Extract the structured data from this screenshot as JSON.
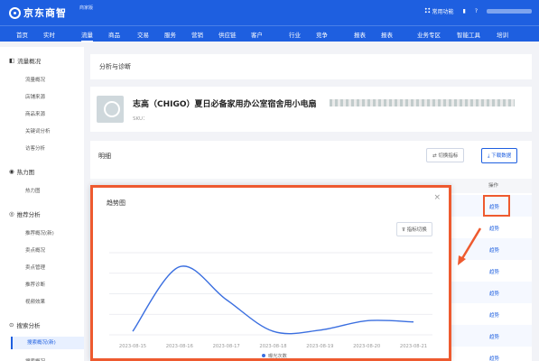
{
  "header": {
    "logo_text": "京东商智",
    "logo_badge": "商家版",
    "common_functions": "常用功能",
    "user_name_hidden": ""
  },
  "nav": {
    "items": [
      "首页",
      "实时",
      "流量",
      "商品",
      "交易",
      "服务",
      "营销",
      "供应链",
      "客户",
      "行业",
      "竞争",
      "报表",
      "报表",
      "业务专区",
      "智能工具",
      "培训"
    ],
    "active_index": 2
  },
  "sidebar": {
    "groups": [
      {
        "label": "流量概况",
        "items": [
          "流量概况",
          "店铺来源",
          "商品来源",
          "关键词分析",
          "访客分析"
        ]
      },
      {
        "label": "热力图",
        "items": [
          "热力图"
        ]
      },
      {
        "label": "推荐分析",
        "items": [
          "推荐概况(新)",
          "卖点概况",
          "卖点管理",
          "推荐诊断",
          "视频效果"
        ]
      },
      {
        "label": "搜索分析",
        "items": [
          "搜索概况(新)",
          "搜索概况"
        ]
      }
    ],
    "active_item": "搜索概况(新)"
  },
  "main": {
    "breadcrumb": "分析与诊断",
    "product_title": "志高（CHIGO）夏日必备家用办公室宿舍用小电扇",
    "product_sku_label": "SKU：",
    "detail_title": "明细",
    "switch_metric_btn": "切换指标",
    "download_btn": "下载数据",
    "op_header": "操作",
    "row_action": "趋势"
  },
  "modal": {
    "title": "趋势图",
    "metric_switch": "指标切换",
    "close": "×"
  },
  "chart_data": {
    "type": "line",
    "x": [
      "2023-08-15",
      "2023-08-16",
      "2023-08-17",
      "2023-08-18",
      "2023-08-19",
      "2023-08-20",
      "2023-08-21"
    ],
    "series": [
      {
        "name": "曝光次数",
        "values": [
          3,
          58,
          30,
          3,
          4,
          12,
          11
        ]
      }
    ],
    "ylim": [
      0,
      70
    ],
    "grid": true,
    "legend": "bottom-center",
    "color": "#3b6fe0"
  }
}
